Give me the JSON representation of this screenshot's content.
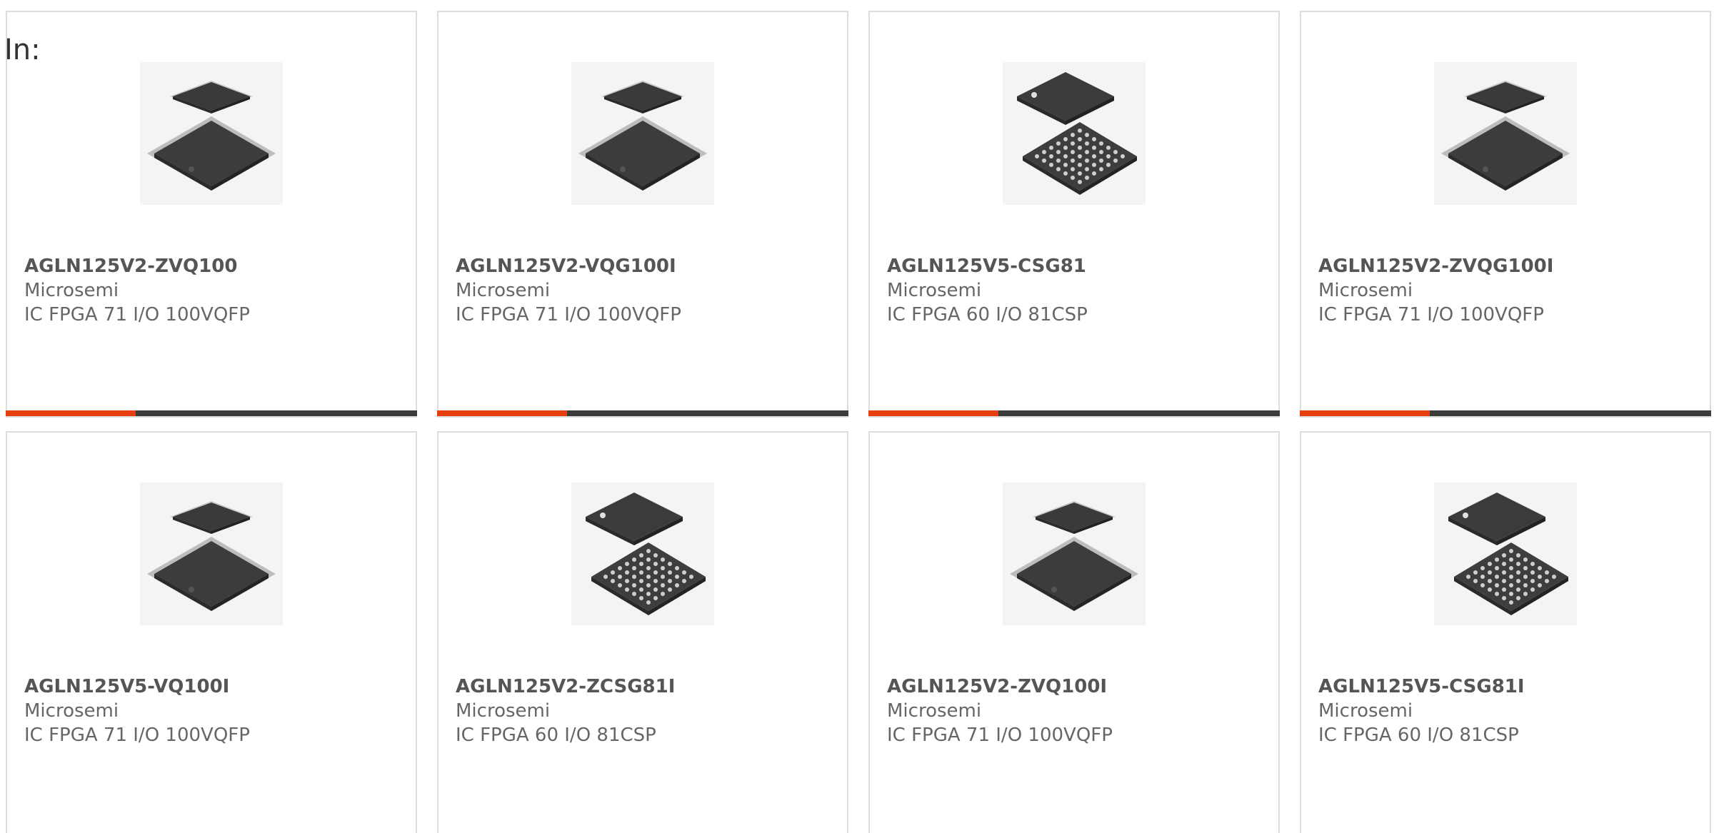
{
  "header": {
    "in_label": "In:"
  },
  "colors": {
    "accent": "#e8400c",
    "bar_dark": "#3c3c3c",
    "card_border": "#dcdcdc",
    "text": "#666666"
  },
  "products": [
    {
      "part_number": "AGLN125V2-ZVQ100",
      "manufacturer": "Microsemi",
      "description": "IC FPGA 71 I/O 100VQFP",
      "image_icon": "vqfp-chip-icon",
      "show_bar": true
    },
    {
      "part_number": "AGLN125V2-VQG100I",
      "manufacturer": "Microsemi",
      "description": "IC FPGA 71 I/O 100VQFP",
      "image_icon": "vqfp-chip-icon",
      "show_bar": true
    },
    {
      "part_number": "AGLN125V5-CSG81",
      "manufacturer": "Microsemi",
      "description": "IC FPGA 60 I/O 81CSP",
      "image_icon": "bga-chip-icon",
      "show_bar": true
    },
    {
      "part_number": "AGLN125V2-ZVQG100I",
      "manufacturer": "Microsemi",
      "description": "IC FPGA 71 I/O 100VQFP",
      "image_icon": "vqfp-chip-icon",
      "show_bar": true
    },
    {
      "part_number": "AGLN125V5-VQ100I",
      "manufacturer": "Microsemi",
      "description": "IC FPGA 71 I/O 100VQFP",
      "image_icon": "vqfp-chip-icon",
      "show_bar": false
    },
    {
      "part_number": "AGLN125V2-ZCSG81I",
      "manufacturer": "Microsemi",
      "description": "IC FPGA 60 I/O 81CSP",
      "image_icon": "bga-chip-icon",
      "show_bar": false
    },
    {
      "part_number": "AGLN125V2-ZVQ100I",
      "manufacturer": "Microsemi",
      "description": "IC FPGA 71 I/O 100VQFP",
      "image_icon": "vqfp-chip-icon",
      "show_bar": false
    },
    {
      "part_number": "AGLN125V5-CSG81I",
      "manufacturer": "Microsemi",
      "description": "IC FPGA 60 I/O 81CSP",
      "image_icon": "bga-chip-icon",
      "show_bar": false
    }
  ]
}
